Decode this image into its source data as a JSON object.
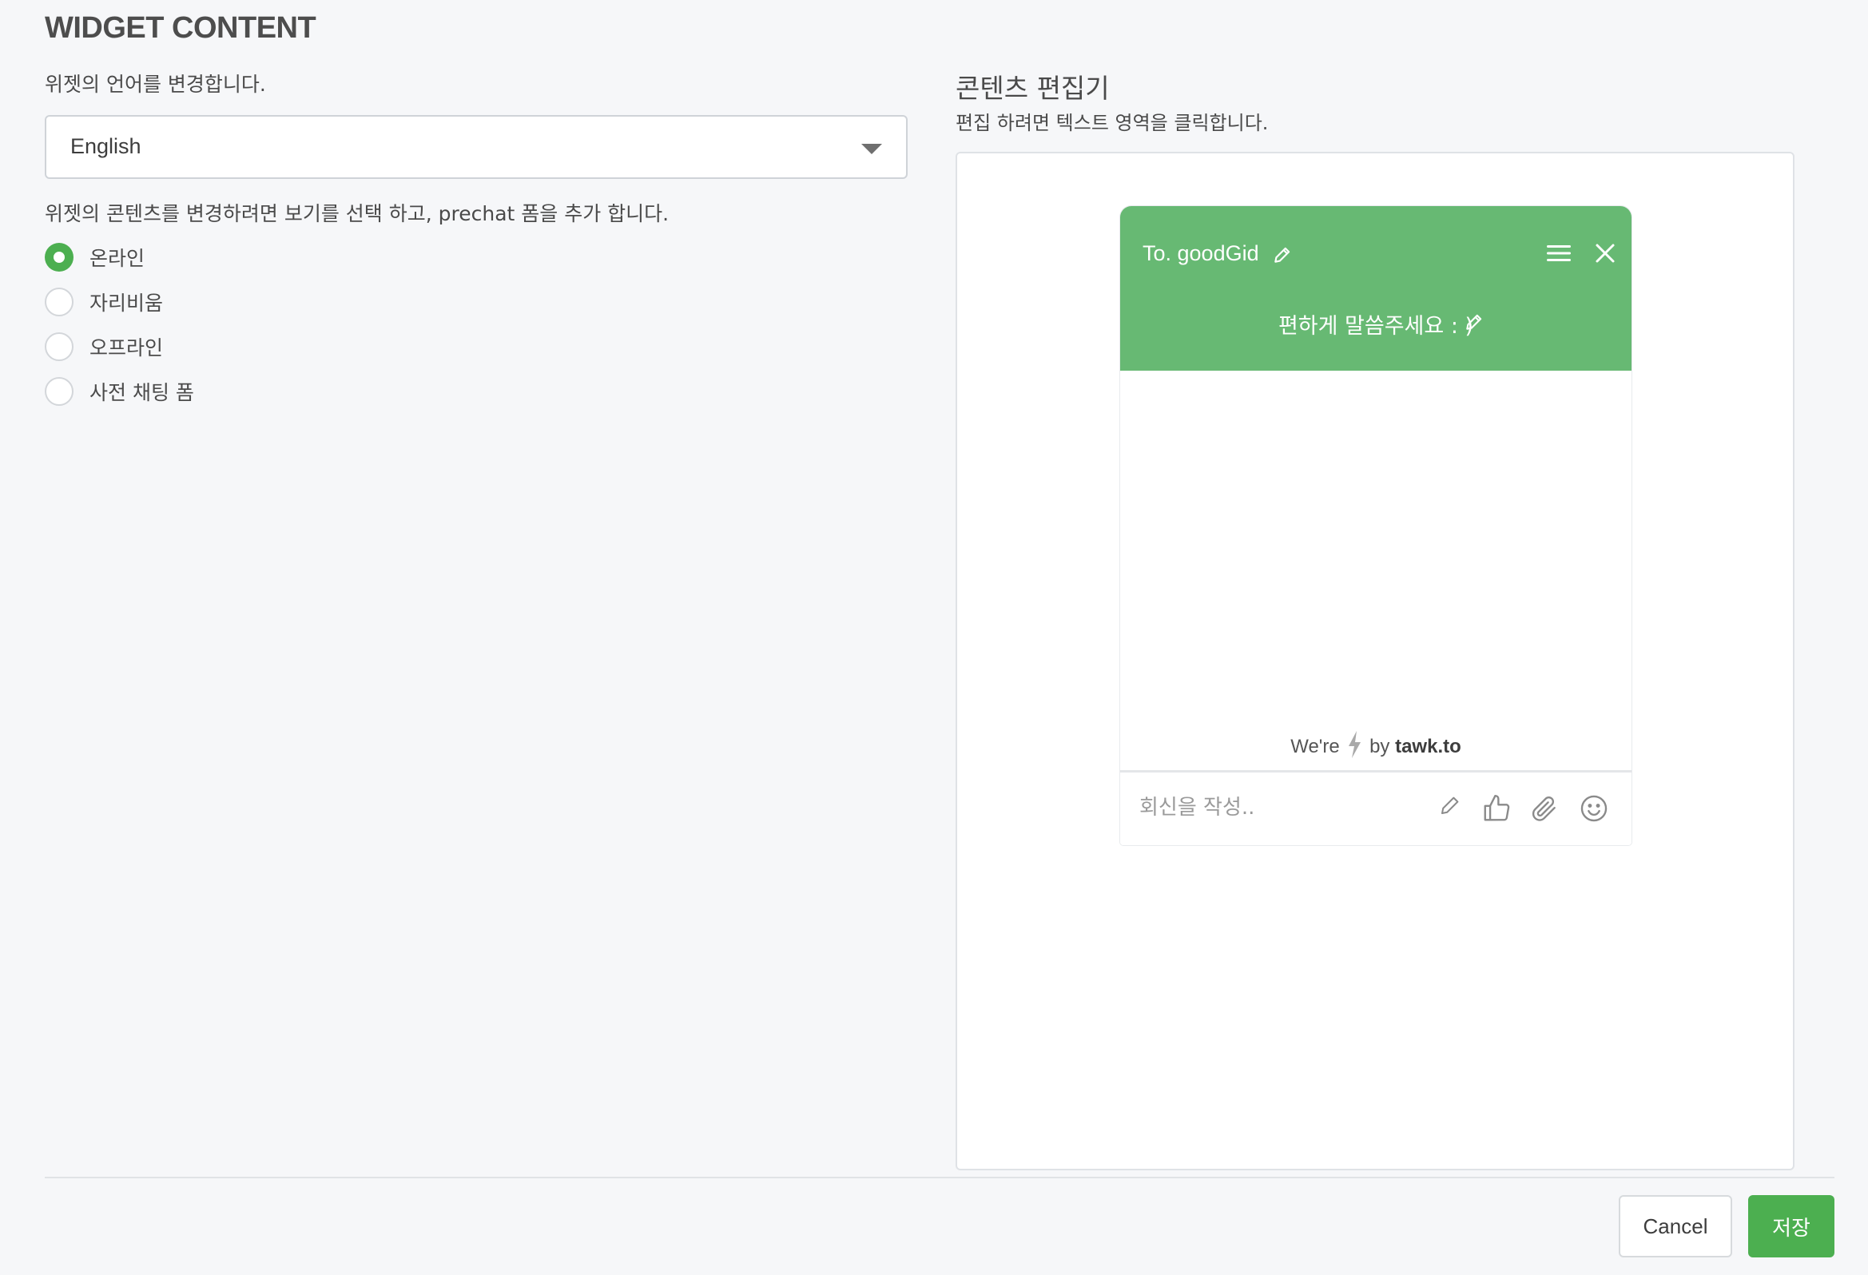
{
  "section_title": "WIDGET CONTENT",
  "language": {
    "description": "위젯의 언어를 변경합니다.",
    "selected": "English"
  },
  "view": {
    "description": "위젯의 콘텐츠를 변경하려면 보기를 선택 하고, prechat 폼을 추가 합니다.",
    "options": [
      {
        "label": "온라인",
        "checked": true
      },
      {
        "label": "자리비움",
        "checked": false
      },
      {
        "label": "오프라인",
        "checked": false
      },
      {
        "label": "사전 채팅 폼",
        "checked": false
      }
    ]
  },
  "editor": {
    "title": "콘텐츠 편집기",
    "description": "편집 하려면 텍스트 영역을 클릭합니다."
  },
  "widget": {
    "title": "To. goodGid",
    "subtitle": "편하게 말씀주세요 : )",
    "branding_prefix": "We're",
    "branding_by": "by",
    "branding_brand": "tawk.to",
    "composer_placeholder": "회신을 작성..",
    "header_color": "#67b973",
    "icons": [
      "edit-icon",
      "menu-icon",
      "close-icon",
      "pencil-icon",
      "thumbs-up-icon",
      "paperclip-icon",
      "smiley-icon",
      "lightning-icon"
    ]
  },
  "footer": {
    "cancel_label": "Cancel",
    "save_label": "저장"
  },
  "colors": {
    "accent": "#4caf50",
    "background": "#f6f7f9"
  }
}
